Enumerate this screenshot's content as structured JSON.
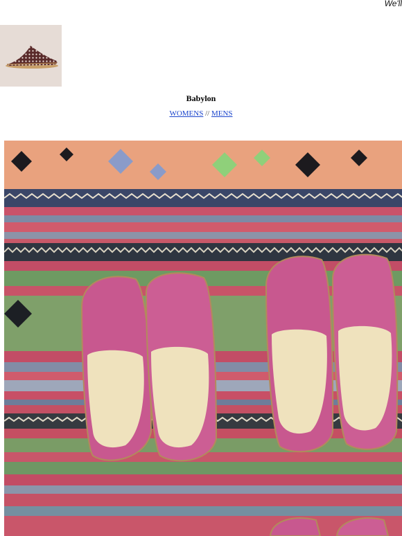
{
  "banner": {
    "text": "We'll"
  },
  "product": {
    "title": "Babylon"
  },
  "nav": {
    "womens_label": "WOMENS",
    "separator": "//",
    "mens_label": "MENS"
  },
  "colors": {
    "link": "#1a44cc",
    "shoe_pink": "#c8588f",
    "insole": "#efe2bd"
  },
  "images": {
    "thumbnail_icon": "slipper-thumbnail",
    "hero_icon": "pink-slippers-on-kilim-rug"
  }
}
